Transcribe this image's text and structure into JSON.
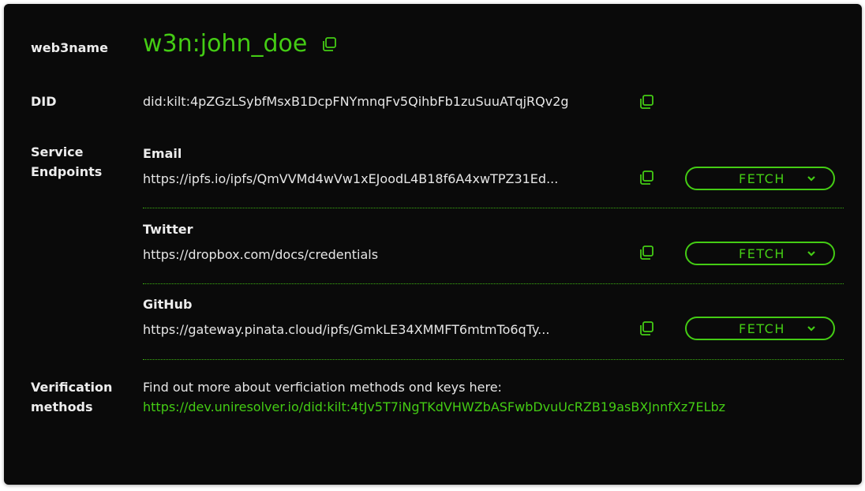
{
  "web3name": {
    "label": "web3name",
    "value": "w3n:john_doe"
  },
  "did": {
    "label": "DID",
    "value": "did:kilt:4pZGzLSybfMsxB1DcpFNYmnqFv5QihbFb1zuSuuATqjRQv2g"
  },
  "service_endpoints": {
    "label": "Service\nEndpoints",
    "fetch_label": "FETCH",
    "items": [
      {
        "name": "Email",
        "url": "https://ipfs.io/ipfs/QmVVMd4wVw1xEJoodL4B18f6A4xwTPZ31Ed..."
      },
      {
        "name": "Twitter",
        "url": "https://dropbox.com/docs/credentials"
      },
      {
        "name": "GitHub",
        "url": "https://gateway.pinata.cloud/ipfs/GmkLE34XMMFT6mtmTo6qTy..."
      }
    ]
  },
  "verification": {
    "label": "Verification\nmethods",
    "text": "Find out more about verficiation methods ond keys here:",
    "link": "https://dev.uniresolver.io/did:kilt:4tJv5T7iNgTKdVHWZbASFwbDvuUcRZB19asBXJnnfXz7ELbz"
  },
  "colors": {
    "accent": "#44cc14",
    "background": "#0a0a0a",
    "text": "#e6e6e6"
  },
  "icons": {
    "copy": "copy-icon",
    "chevron": "chevron-down-icon"
  }
}
